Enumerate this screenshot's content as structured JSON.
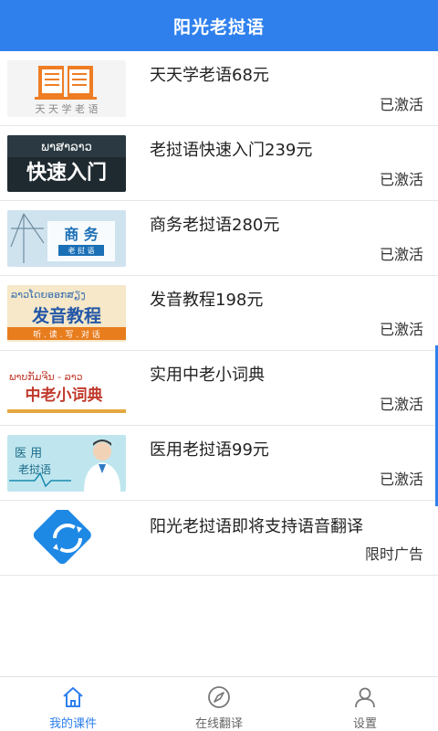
{
  "header": {
    "title": "阳光老挝语"
  },
  "courses": [
    {
      "title": "天天学老语68元",
      "status": "已激活",
      "thumb_text": "天 天 学 老 语",
      "icon": "book-icon"
    },
    {
      "title": "老挝语快速入门239元",
      "status": "已激活",
      "thumb_lao": "ພາສາລາວ",
      "thumb_text": "快速入门"
    },
    {
      "title": "商务老挝语280元",
      "status": "已激活",
      "thumb_text": "商 务",
      "thumb_sub": "老 挝 语"
    },
    {
      "title": "发音教程198元",
      "status": "已激活",
      "thumb_lao": "ລາວໂດຍອອກສຽງ",
      "thumb_text": "发音教程",
      "thumb_sub": "听 . 读 . 写 . 对 话"
    },
    {
      "title": "实用中老小词典",
      "status": "已激活",
      "thumb_lao": "ພາບກັມຈີນ - ລາວ",
      "thumb_text": "中老小词典"
    },
    {
      "title": "医用老挝语99元",
      "status": "已激活",
      "thumb_text": "医 用",
      "thumb_sub": "老挝语",
      "icon": "doctor-icon"
    }
  ],
  "ad": {
    "title": "阳光老挝语即将支持语音翻译",
    "status": "限时广告",
    "icon": "refresh-icon"
  },
  "tabs": [
    {
      "label": "我的课件",
      "icon": "home-icon",
      "active": true
    },
    {
      "label": "在线翻译",
      "icon": "compass-icon",
      "active": false
    },
    {
      "label": "设置",
      "icon": "user-icon",
      "active": false
    }
  ],
  "colors": {
    "primary": "#2f80ed",
    "text": "#222222",
    "divider": "#e6e6e6"
  }
}
